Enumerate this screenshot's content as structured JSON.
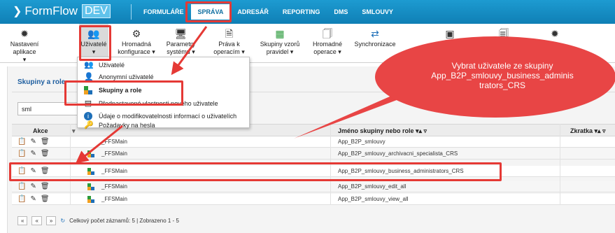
{
  "app": {
    "logo_text": "FormFlow",
    "env_badge": "DEV",
    "brand_color": "#1a8fc8"
  },
  "top_nav": [
    {
      "label": "FORMULÁŘE",
      "active": false
    },
    {
      "label": "SPRÁVA",
      "active": true
    },
    {
      "label": "ADRESÁŘ",
      "active": false
    },
    {
      "label": "REPORTING",
      "active": false
    },
    {
      "label": "DMS",
      "active": false
    },
    {
      "label": "SMLOUVY",
      "active": false
    }
  ],
  "toolbar": [
    {
      "label": "Nastavení aplikace",
      "icon": "gear-icon"
    },
    {
      "label": "Uživatelé",
      "icon": "users-icon"
    },
    {
      "label": "Hromadná konfigurace ▾",
      "icon": "gears-icon"
    },
    {
      "label": "Parametry systému ▾",
      "icon": "monitor-icon"
    },
    {
      "label": "Práva k operacím ▾",
      "icon": "doc-icon"
    },
    {
      "label": "Skupiny vzorů pravidel ▾",
      "icon": "grid-icon"
    },
    {
      "label": "Hromadné operace ▾",
      "icon": "docs-icon"
    },
    {
      "label": "Synchronizace",
      "icon": "sync-icon"
    },
    {
      "label": "",
      "icon": "calendar-icon"
    },
    {
      "label": "",
      "icon": "files-icon"
    },
    {
      "label": "",
      "icon": "gear-icon"
    }
  ],
  "dropdown": {
    "items": [
      {
        "label": "Uživatelé",
        "icon": "users-icon"
      },
      {
        "label": "Anonymní uživatelé",
        "icon": "user-icon"
      },
      {
        "label": "Skupiny a role",
        "icon": "group-icon"
      },
      {
        "label": "Přednastavené vlastnosti nového uživatele",
        "icon": "list-icon"
      },
      {
        "label": "Údaje o modifikovatelnosti informací o uživatelích",
        "icon": "info-icon"
      },
      {
        "label": "Požadavky na hesla",
        "icon": "key-icon"
      }
    ]
  },
  "panel": {
    "title": "Skupiny a role",
    "search_value": "sml"
  },
  "table": {
    "headers": {
      "actions": "Akce",
      "name": "Jméno skupiny nebo role ▾▴ ▿",
      "abbr": "Zkratka ▾▴ ▿"
    },
    "rows": [
      {
        "group": "_FFSMain",
        "name": "App_B2P_smlouvy"
      },
      {
        "group": "_FFSMain",
        "name": "App_B2P_smlouvy_archivacni_specialista_CRS"
      },
      {
        "group": "_FFSMain",
        "name": "App_B2P_smlouvy_business_administrators_CRS"
      },
      {
        "group": "_FFSMain",
        "name": "App_B2P_smlouvy_edit_all"
      },
      {
        "group": "_FFSMain",
        "name": "App_B2P_smlouvy_view_all"
      }
    ]
  },
  "footer": {
    "first": "«",
    "prev": "«",
    "next": "»",
    "summary": "Celkový počet záznamů: 5 | Zobrazeno 1 - 5"
  },
  "callout": {
    "text": "Vybrat uživatele ze skupiny App_B2P_smlouvy_business_adminis trators_CRS",
    "color": "#e84545"
  }
}
